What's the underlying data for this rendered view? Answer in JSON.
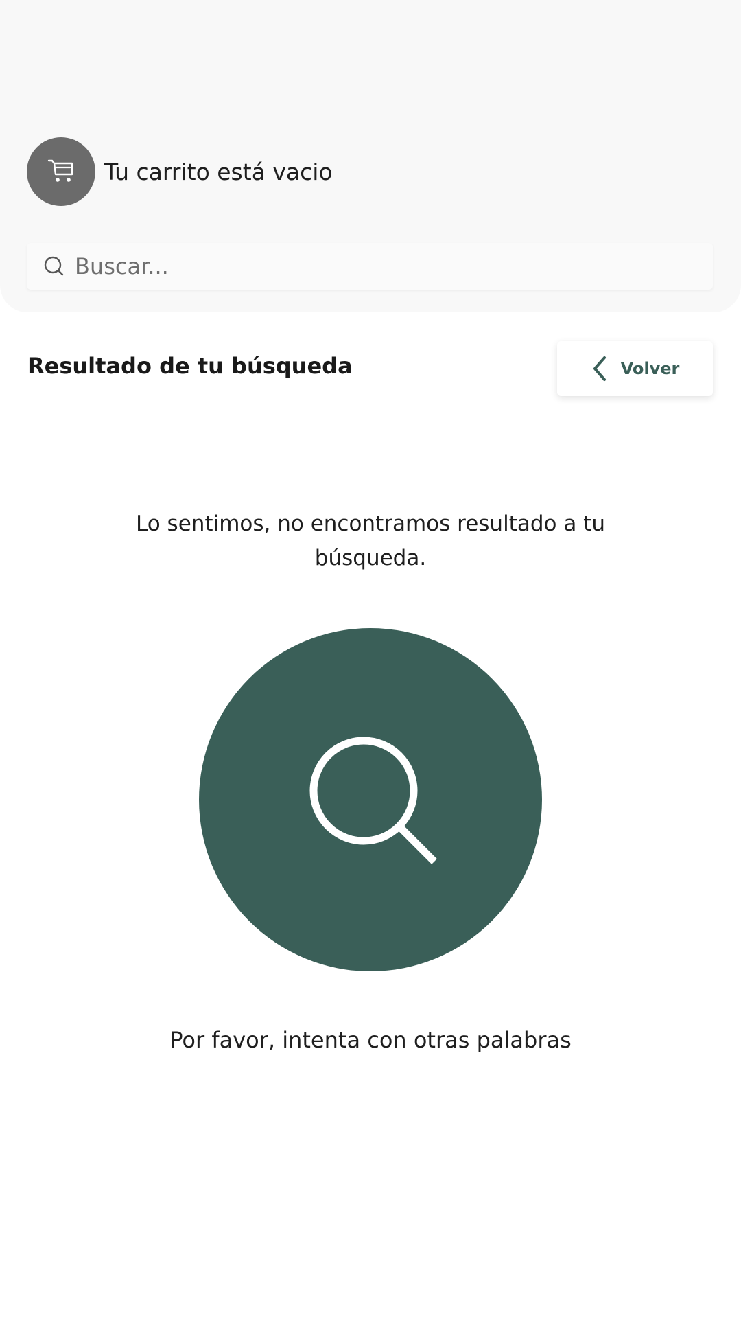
{
  "cart": {
    "icon": "cart-icon",
    "status_text": "Tu carrito está vacio"
  },
  "search": {
    "icon": "search-icon",
    "placeholder": "Buscar...",
    "value": ""
  },
  "results": {
    "title": "Resultado de tu búsqueda",
    "back_button": {
      "icon": "chevron-left-icon",
      "label": "Volver"
    }
  },
  "empty_state": {
    "message": "Lo sentimos, no encontramos resultado a tu búsqueda.",
    "illustration_icon": "magnifier-icon",
    "hint": "Por favor, intenta con otras palabras"
  },
  "colors": {
    "accent": "#3a5f58",
    "cart_avatar": "#6b6b6b",
    "header_background": "#f8f8f8"
  }
}
